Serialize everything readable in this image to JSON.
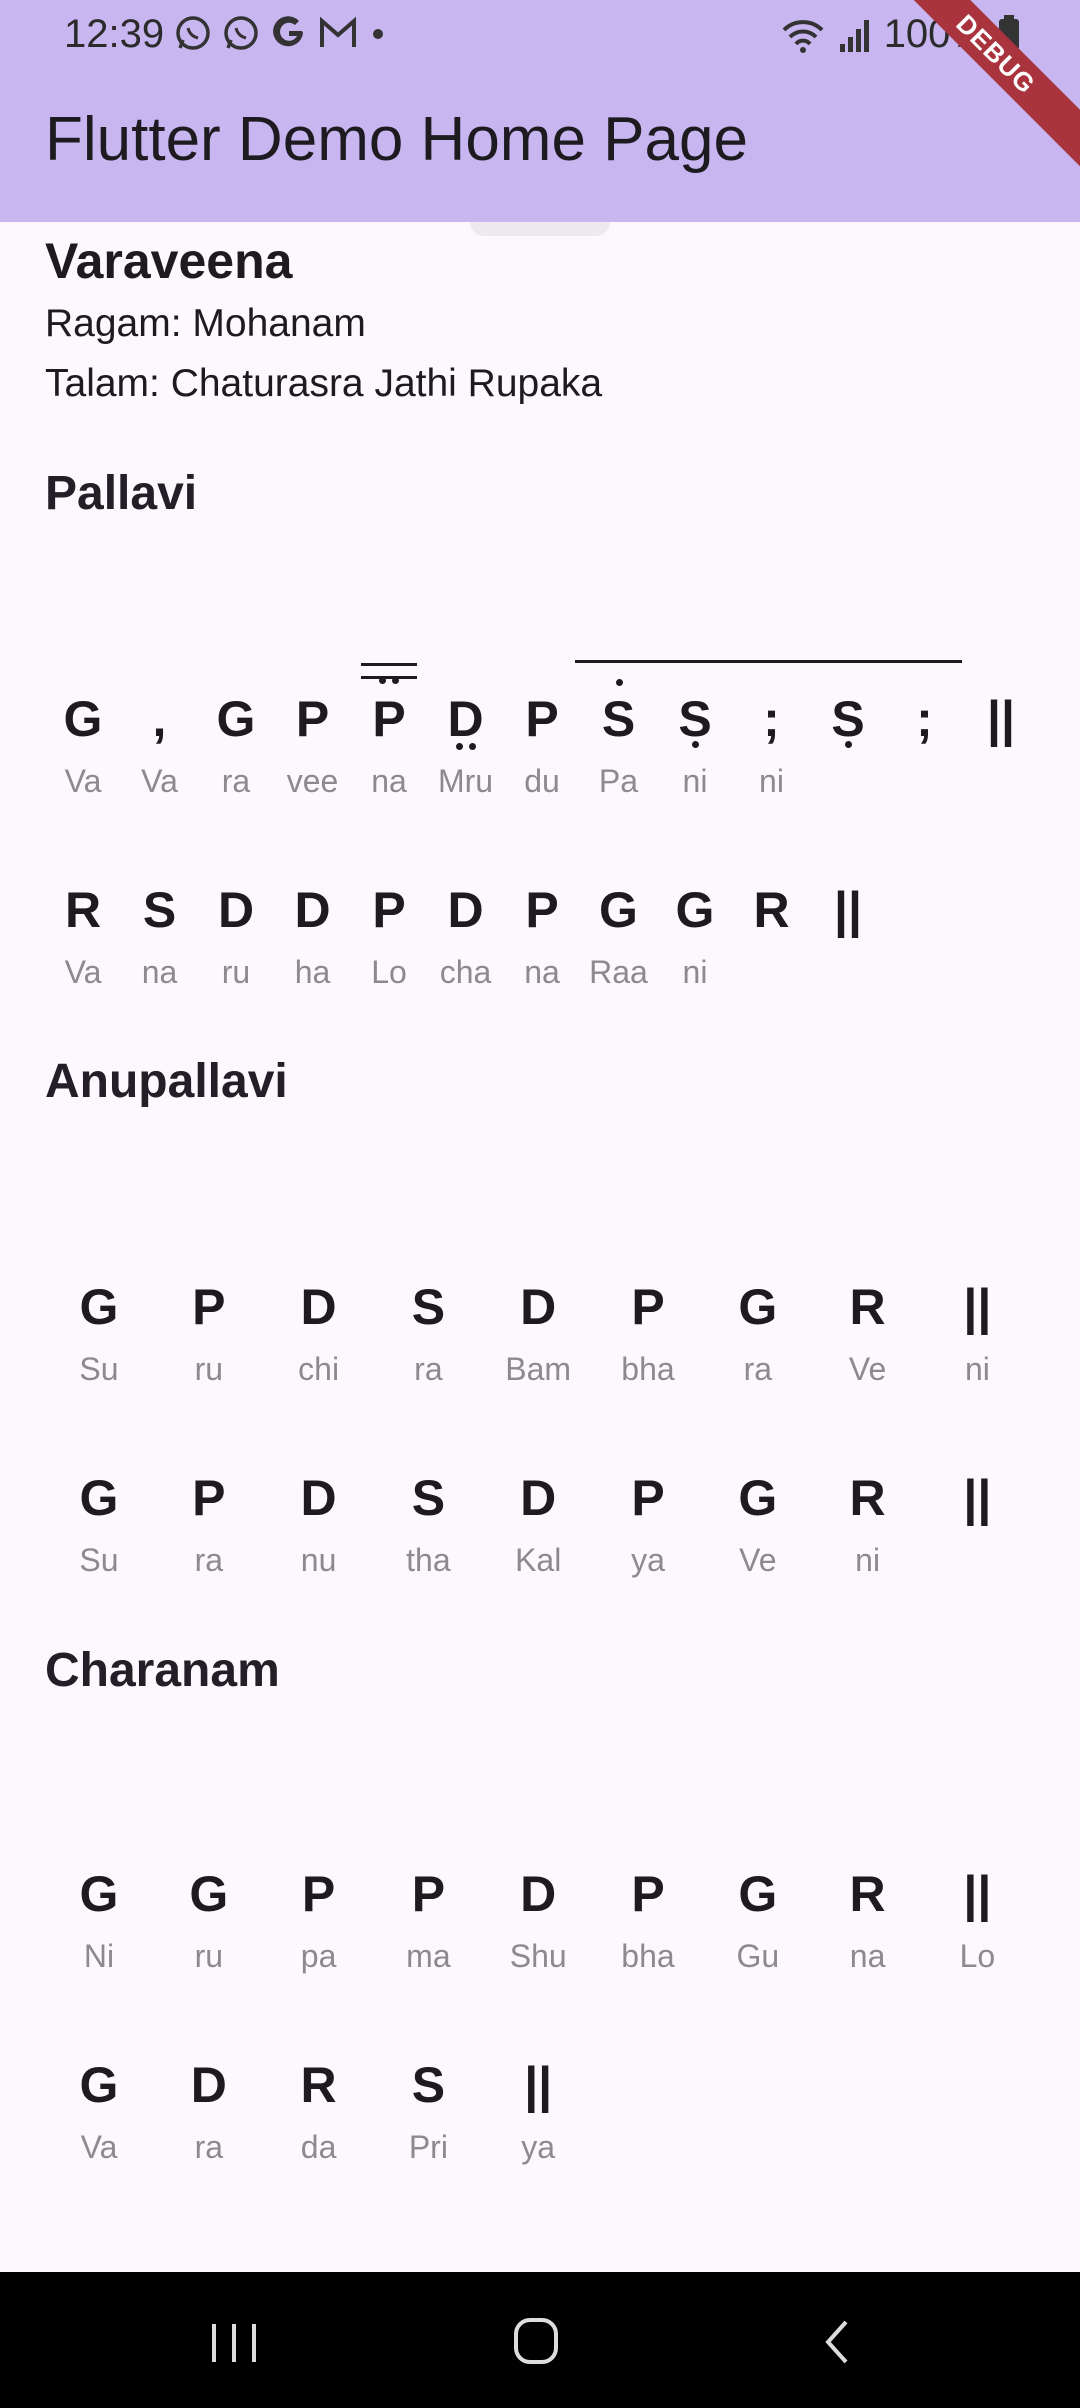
{
  "status_bar": {
    "time": "12:39",
    "battery": "100%",
    "icons": [
      "whatsapp-icon",
      "whatsapp-icon",
      "google-icon",
      "gmail-icon",
      "dot-icon",
      "wifi-icon",
      "signal-icon",
      "battery-icon"
    ]
  },
  "app_bar": {
    "title": "Flutter Demo Home Page",
    "debug_label": "DEBUG",
    "color": "#c8b6f1"
  },
  "song": {
    "title": "Varaveena",
    "ragam": "Ragam: Mohanam",
    "talam": "Talam: Chaturasra Jathi Rupaka"
  },
  "sections": {
    "pallavi": "Pallavi",
    "anupallavi": "Anupallavi",
    "charanam": "Charanam"
  },
  "pallavi_row1": [
    {
      "s": "G",
      "l": "Va"
    },
    {
      "s": ",",
      "l": "Va"
    },
    {
      "s": "G",
      "l": "ra"
    },
    {
      "s": "P",
      "l": "vee"
    },
    {
      "s": "P",
      "l": "na"
    },
    {
      "s": "D",
      "l": "Mru"
    },
    {
      "s": "P",
      "l": "du"
    },
    {
      "s": "S",
      "l": "Pa"
    },
    {
      "s": "S",
      "l": "ni"
    },
    {
      "s": ";",
      "l": "ni"
    },
    {
      "s": "S",
      "l": ""
    },
    {
      "s": ";",
      "l": ""
    },
    {
      "s": "||",
      "l": ""
    }
  ],
  "pallavi_row2": [
    {
      "s": "R",
      "l": "Va"
    },
    {
      "s": "S",
      "l": "na"
    },
    {
      "s": "D",
      "l": "ru"
    },
    {
      "s": "D",
      "l": "ha"
    },
    {
      "s": "P",
      "l": "Lo"
    },
    {
      "s": "D",
      "l": "cha"
    },
    {
      "s": "P",
      "l": "na"
    },
    {
      "s": "G",
      "l": "Raa"
    },
    {
      "s": "G",
      "l": "ni"
    },
    {
      "s": "R",
      "l": ""
    },
    {
      "s": "||",
      "l": ""
    }
  ],
  "anupallavi_row1": [
    {
      "s": "G",
      "l": "Su"
    },
    {
      "s": "P",
      "l": "ru"
    },
    {
      "s": "D",
      "l": "chi"
    },
    {
      "s": "S",
      "l": "ra"
    },
    {
      "s": "D",
      "l": "Bam"
    },
    {
      "s": "P",
      "l": "bha"
    },
    {
      "s": "G",
      "l": "ra"
    },
    {
      "s": "R",
      "l": "Ve"
    },
    {
      "s": "||",
      "l": "ni"
    }
  ],
  "anupallavi_row2": [
    {
      "s": "G",
      "l": "Su"
    },
    {
      "s": "P",
      "l": "ra"
    },
    {
      "s": "D",
      "l": "nu"
    },
    {
      "s": "S",
      "l": "tha"
    },
    {
      "s": "D",
      "l": "Kal"
    },
    {
      "s": "P",
      "l": "ya"
    },
    {
      "s": "G",
      "l": "Ve"
    },
    {
      "s": "R",
      "l": "ni"
    },
    {
      "s": "||",
      "l": ""
    }
  ],
  "charanam_row1": [
    {
      "s": "G",
      "l": "Ni"
    },
    {
      "s": "G",
      "l": "ru"
    },
    {
      "s": "P",
      "l": "pa"
    },
    {
      "s": "P",
      "l": "ma"
    },
    {
      "s": "D",
      "l": "Shu"
    },
    {
      "s": "P",
      "l": "bha"
    },
    {
      "s": "G",
      "l": "Gu"
    },
    {
      "s": "R",
      "l": "na"
    },
    {
      "s": "||",
      "l": "Lo"
    }
  ],
  "charanam_row2": [
    {
      "s": "G",
      "l": "Va"
    },
    {
      "s": "D",
      "l": "ra"
    },
    {
      "s": "R",
      "l": "da"
    },
    {
      "s": "S",
      "l": "Pri"
    },
    {
      "s": "||",
      "l": "ya"
    }
  ],
  "nav": [
    "recent-apps-icon",
    "home-icon",
    "back-icon"
  ]
}
